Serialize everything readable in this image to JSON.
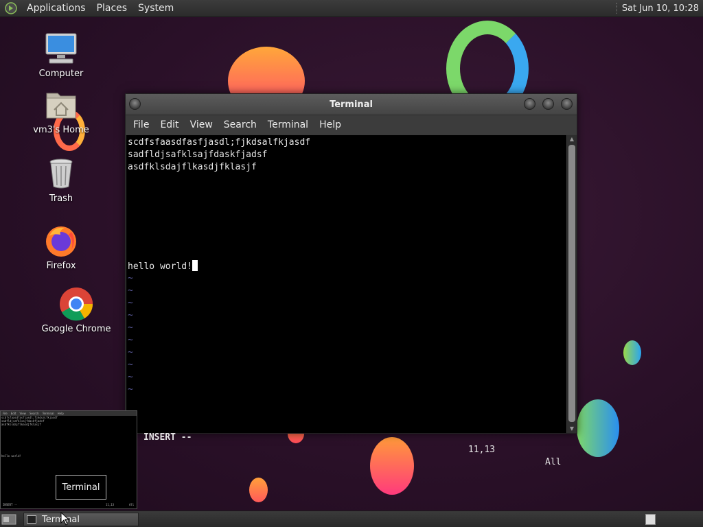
{
  "top_panel": {
    "menus": [
      "Applications",
      "Places",
      "System"
    ],
    "clock": "Sat Jun 10, 10:28"
  },
  "desktop_icons": {
    "computer": "Computer",
    "home": "vm3's Home",
    "trash": "Trash",
    "firefox": "Firefox",
    "chrome": "Google Chrome"
  },
  "terminal": {
    "title": "Terminal",
    "menus": [
      "File",
      "Edit",
      "View",
      "Search",
      "Terminal",
      "Help"
    ],
    "lines": [
      "scdfsfaasdfasfjasdl;fjkdsalfkjasdf",
      "sadfldjsafklsajfdaskfjadsf",
      "asdfklsdajflkasdjfklasjf"
    ],
    "cursor_line": "hello world!",
    "tilde": "~",
    "status_mode": "INSERT --",
    "status_pos": "11,13",
    "status_all": "All"
  },
  "preview": {
    "tooltip": "Terminal"
  },
  "taskbar": {
    "task_label": "Terminal"
  },
  "colors": {
    "accent_orange": "#ff7a3c",
    "accent_pink": "#ff3a7c",
    "accent_green": "#7cd86a",
    "accent_blue": "#3aa8f0"
  }
}
